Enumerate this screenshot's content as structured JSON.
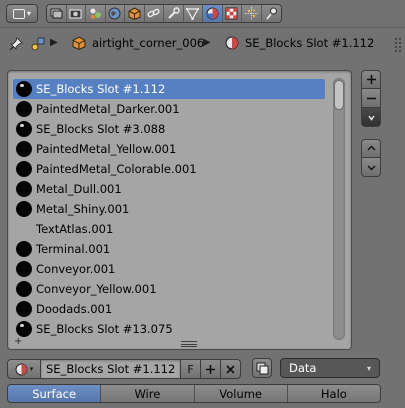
{
  "header": {
    "editor_type_icon": "editor-type-icon",
    "context_tabs": [
      {
        "name": "render-layers",
        "active": false
      },
      {
        "name": "render",
        "active": false
      },
      {
        "name": "scene",
        "active": false
      },
      {
        "name": "world",
        "active": false
      },
      {
        "name": "object",
        "active": false
      },
      {
        "name": "constraints",
        "active": false
      },
      {
        "name": "modifiers",
        "active": false
      },
      {
        "name": "data",
        "active": false
      },
      {
        "name": "material",
        "active": true
      },
      {
        "name": "texture",
        "active": false
      },
      {
        "name": "particles",
        "active": false
      },
      {
        "name": "physics",
        "active": false
      }
    ]
  },
  "breadcrumb": {
    "object": "airtight_corner_006",
    "material": "SE_Blocks Slot #1.112"
  },
  "material_slots": [
    {
      "name": "SE_Blocks Slot #1.112",
      "selected": true,
      "icon": "shiny"
    },
    {
      "name": "PaintedMetal_Darker.001",
      "selected": false,
      "icon": "solid"
    },
    {
      "name": "SE_Blocks Slot #3.088",
      "selected": false,
      "icon": "shiny"
    },
    {
      "name": "PaintedMetal_Yellow.001",
      "selected": false,
      "icon": "solid"
    },
    {
      "name": "PaintedMetal_Colorable.001",
      "selected": false,
      "icon": "solid"
    },
    {
      "name": "Metal_Dull.001",
      "selected": false,
      "icon": "solid"
    },
    {
      "name": "Metal_Shiny.001",
      "selected": false,
      "icon": "solid"
    },
    {
      "name": "TextAtlas.001",
      "selected": false,
      "icon": "none"
    },
    {
      "name": "Terminal.001",
      "selected": false,
      "icon": "solid"
    },
    {
      "name": "Conveyor.001",
      "selected": false,
      "icon": "solid"
    },
    {
      "name": "Conveyor_Yellow.001",
      "selected": false,
      "icon": "solid"
    },
    {
      "name": "Doodads.001",
      "selected": false,
      "icon": "solid"
    },
    {
      "name": "SE_Blocks Slot #13.075",
      "selected": false,
      "icon": "shiny"
    }
  ],
  "side_buttons": {
    "add": "+",
    "remove": "−"
  },
  "datablock": {
    "name": "SE_Blocks Slot #1.112",
    "fake_user": "F",
    "link_mode": "Data"
  },
  "preview_tabs": [
    {
      "label": "Surface",
      "active": true
    },
    {
      "label": "Wire",
      "active": false
    },
    {
      "label": "Volume",
      "active": false
    },
    {
      "label": "Halo",
      "active": false
    }
  ],
  "colors": {
    "panel_bg": "#727272",
    "list_bg": "#a5a5a5",
    "accent": "#5680c2"
  }
}
